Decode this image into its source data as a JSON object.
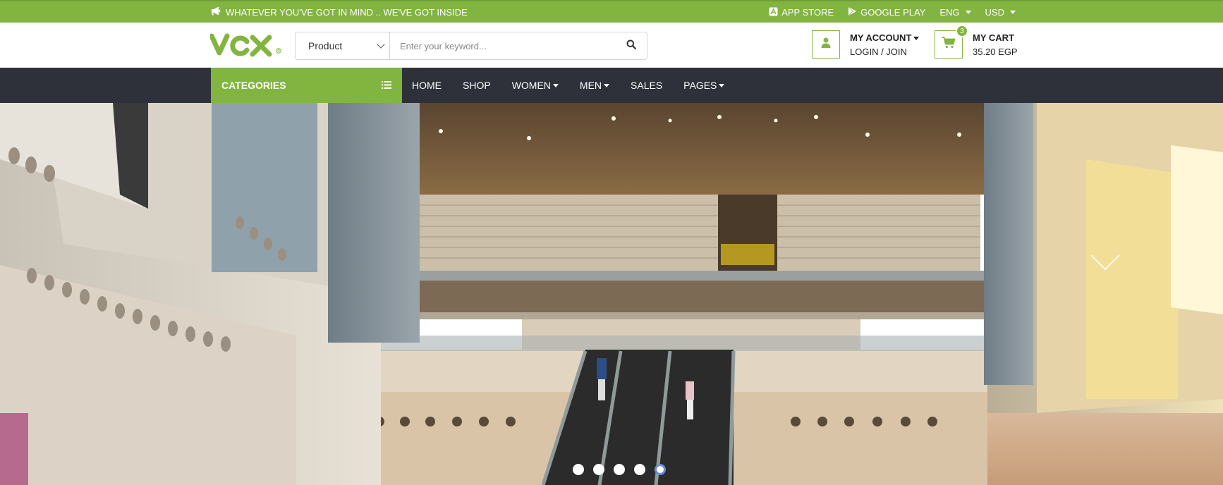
{
  "topbar": {
    "promo_text": "WHATEVER YOU'VE GOT IN MIND .. WE'VE GOT INSIDE",
    "app_store": "APP STORE",
    "google_play": "GOOGLE PLAY",
    "language": "ENG",
    "currency": "USD"
  },
  "header": {
    "logo_text": "VOX",
    "search": {
      "category": "Product",
      "placeholder": "Enter your keyword..."
    },
    "account": {
      "title": "MY ACCOUNT",
      "subtitle": "LOGIN / JOIN"
    },
    "cart": {
      "title": "MY CART",
      "total": "35.20 EGP",
      "count": "3"
    }
  },
  "nav": {
    "categories_label": "CATEGORIES",
    "items": [
      {
        "label": "HOME"
      },
      {
        "label": "SHOP"
      },
      {
        "label": "WOMEN"
      },
      {
        "label": "MEN"
      },
      {
        "label": "SALES"
      },
      {
        "label": "PAGES"
      }
    ]
  },
  "hero": {
    "slides": 5,
    "active_slide": 5
  },
  "colors": {
    "brand_green": "#82b440",
    "nav_dark": "#2e3139",
    "active_dot_border": "#6c8bd6"
  },
  "icons": {
    "promo": "megaphone-icon",
    "app_store": "app-store-icon",
    "google_play": "google-play-icon",
    "search": "search-icon",
    "account": "user-icon",
    "cart": "cart-icon",
    "categories": "list-icon"
  }
}
